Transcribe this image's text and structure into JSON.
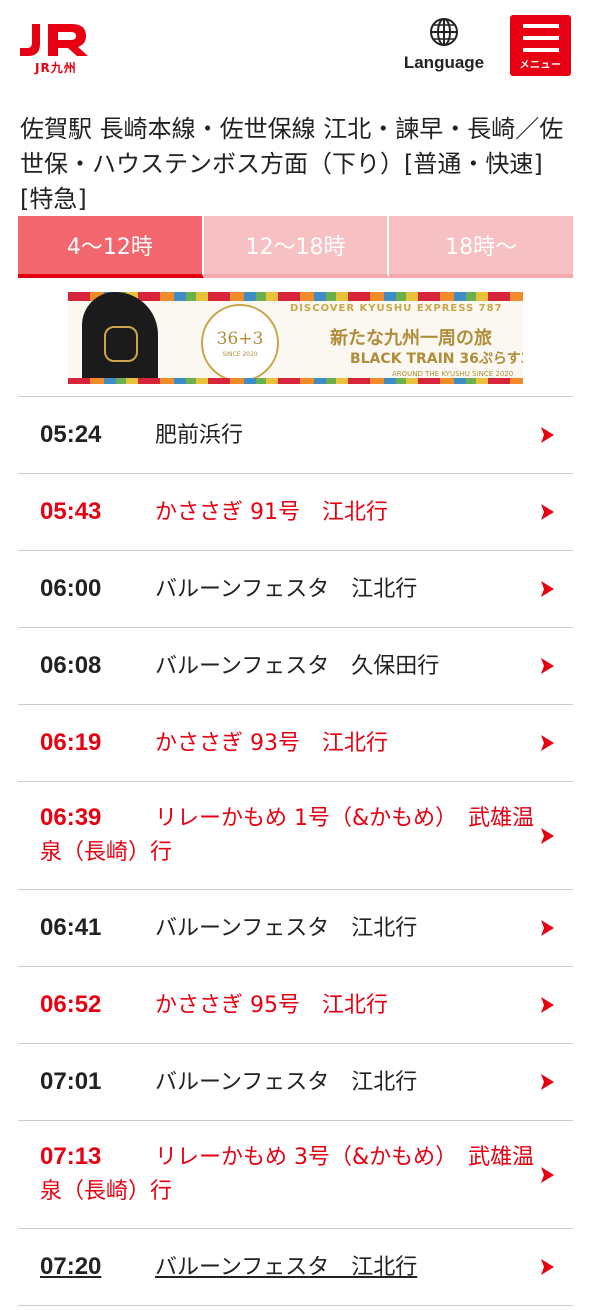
{
  "header": {
    "logo_text": "JR",
    "logo_sub": "JR九州",
    "language_label": "Language",
    "menu_label": "メニュー"
  },
  "title": "佐賀駅 長崎本線・佐世保線 江北・諫早・長崎／佐世保・ハウステンボス方面（下り）[普通・快速] [特急]",
  "tabs": [
    {
      "label": "4〜12時",
      "active": true
    },
    {
      "label": "12〜18時",
      "active": false
    },
    {
      "label": "18時〜",
      "active": false
    }
  ],
  "banner": {
    "emblem": "36+3",
    "emblem_since": "SINCE 2020",
    "en_top": "DISCOVER KYUSHU EXPRESS 787",
    "jp": "新たな九州一周の旅",
    "en": "BLACK TRAIN 36ぷらす3",
    "since": "AROUND THE KYUSHU SINCE 2020"
  },
  "colors": {
    "brand_red": "#e60012",
    "tab_active": "#f1676d",
    "tab_inactive": "#f7c1c4"
  },
  "departures": [
    {
      "time": "05:24",
      "dest": "肥前浜行",
      "express": false
    },
    {
      "time": "05:43",
      "dest": "かささぎ 91号　江北行",
      "express": true
    },
    {
      "time": "06:00",
      "dest": "バルーンフェスタ　江北行",
      "express": false
    },
    {
      "time": "06:08",
      "dest": "バルーンフェスタ　久保田行",
      "express": false
    },
    {
      "time": "06:19",
      "dest": "かささぎ 93号　江北行",
      "express": true
    },
    {
      "time": "06:39",
      "dest": "リレーかもめ 1号（&かもめ）　武雄温泉（長崎）行",
      "express": true
    },
    {
      "time": "06:41",
      "dest": "バルーンフェスタ　江北行",
      "express": false
    },
    {
      "time": "06:52",
      "dest": "かささぎ 95号　江北行",
      "express": true
    },
    {
      "time": "07:01",
      "dest": "バルーンフェスタ　江北行",
      "express": false
    },
    {
      "time": "07:13",
      "dest": "リレーかもめ 3号（&かもめ）　武雄温泉（長崎）行",
      "express": true
    },
    {
      "time": "07:20",
      "dest": "バルーンフェスタ　江北行",
      "express": false
    }
  ]
}
